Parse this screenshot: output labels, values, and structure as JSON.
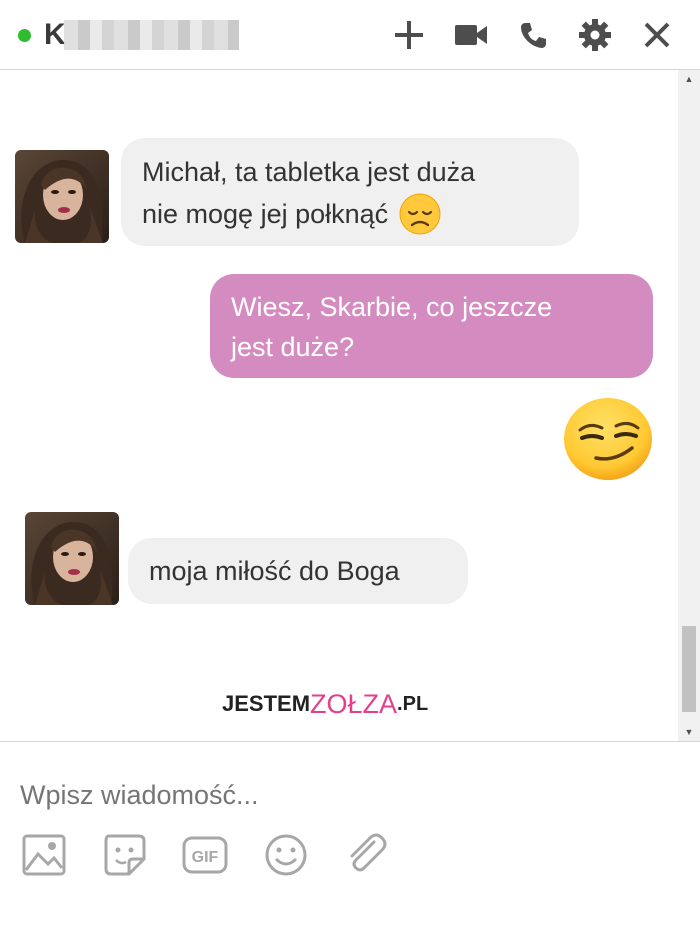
{
  "header": {
    "contact_initial": "K",
    "status": "online",
    "icons": [
      "plus-icon",
      "video-icon",
      "phone-icon",
      "gear-icon",
      "close-icon"
    ]
  },
  "messages": [
    {
      "direction": "incoming",
      "lines": [
        "Michał, ta tabletka jest duża",
        "nie mogę jej połknąć"
      ],
      "emoji": "disappointed-face"
    },
    {
      "direction": "outgoing",
      "lines": [
        "Wiesz, Skarbie, co jeszcze",
        "jest duże?"
      ]
    },
    {
      "direction": "outgoing",
      "emoji": "smirking-face"
    },
    {
      "direction": "incoming",
      "lines": [
        "moja miłość do Boga"
      ]
    }
  ],
  "watermark": {
    "part1": "JESTEM",
    "part2": "ZOŁZA",
    "part3": ".PL"
  },
  "composer": {
    "placeholder": "Wpisz wiadomość...",
    "tools": [
      "image-icon",
      "sticker-icon",
      "gif-icon",
      "emoji-icon",
      "attachment-icon"
    ],
    "gif_label": "GIF"
  },
  "colors": {
    "outgoing_bubble": "#d48cc0",
    "incoming_bubble": "#f1f0f0",
    "online_dot": "#2ebd2e"
  }
}
